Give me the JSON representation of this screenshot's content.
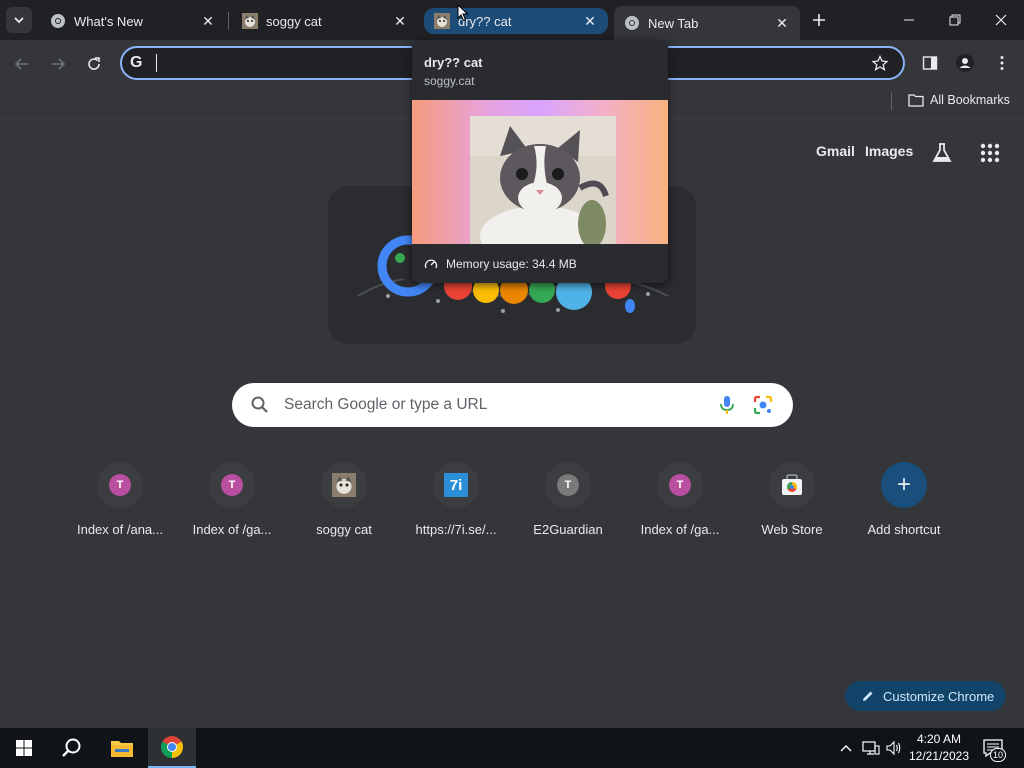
{
  "tabs": [
    {
      "title": "What's New",
      "favicon": "chrome-icon"
    },
    {
      "title": "soggy cat",
      "favicon": "cat-thumbnail-icon"
    },
    {
      "title": "dry?? cat",
      "favicon": "cat-thumbnail-icon",
      "hovered": true
    },
    {
      "title": "New Tab",
      "favicon": "chrome-icon",
      "active": true
    }
  ],
  "omnibox": {
    "value": ""
  },
  "bookmarks": {
    "all_label": "All Bookmarks"
  },
  "hover_card": {
    "title": "dry?? cat",
    "domain": "soggy.cat",
    "memory": "Memory usage: 34.4 MB"
  },
  "ntp": {
    "links": [
      "Gmail",
      "Images"
    ],
    "search_placeholder": "Search Google or type a URL",
    "shortcuts": [
      {
        "label": "Index of /ana...",
        "icon_letter": "T",
        "color": "#b94f9e"
      },
      {
        "label": "Index of /ga...",
        "icon_letter": "T",
        "color": "#b94f9e"
      },
      {
        "label": "soggy cat",
        "icon_letter": "",
        "color": "#9d8e7b"
      },
      {
        "label": "https://7i.se/...",
        "icon_letter": "7i",
        "color": "#2a8fd6"
      },
      {
        "label": "E2Guardian",
        "icon_letter": "T",
        "color": "#7a7a7a"
      },
      {
        "label": "Index of /ga...",
        "icon_letter": "T",
        "color": "#b94f9e"
      },
      {
        "label": "Web Store",
        "icon_letter": "",
        "color": "#ffffff"
      },
      {
        "label": "Add shortcut",
        "icon_letter": "+",
        "color": "#1a4f7d"
      }
    ],
    "customize_label": "Customize Chrome"
  },
  "taskbar": {
    "time": "4:20 AM",
    "date": "12/21/2023",
    "notifications": "10"
  },
  "colors": {
    "tab_strip": "#202124",
    "toolbar": "#35363a",
    "accent": "#8ab4f8",
    "hover_tab": "#1e4c79",
    "customize_bg": "#124469"
  }
}
